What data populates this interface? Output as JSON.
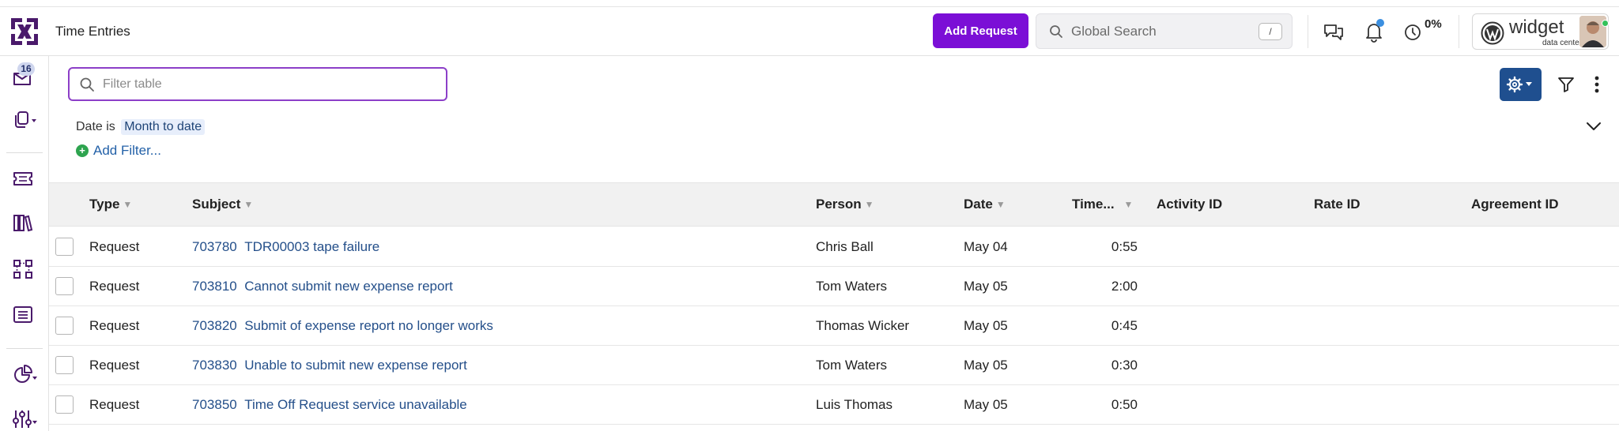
{
  "header": {
    "title": "Time Entries",
    "add_request_label": "Add Request",
    "global_search_placeholder": "Global Search",
    "search_shortcut": "/",
    "timer_percent": "0%",
    "brand_name": "widget",
    "brand_sub": "data center"
  },
  "sidebar": {
    "inbox_badge": "16"
  },
  "filter": {
    "placeholder": "Filter table",
    "date_label": "Date is",
    "date_value": "Month to date",
    "add_filter_label": "Add Filter..."
  },
  "table": {
    "columns": [
      "Type",
      "Subject",
      "Person",
      "Date",
      "Time...",
      "Activity ID",
      "Rate ID",
      "Agreement ID"
    ],
    "rows": [
      {
        "type": "Request",
        "id": "703780",
        "subject": "TDR00003 tape failure",
        "person": "Chris Ball",
        "date": "May 04",
        "time": "0:55"
      },
      {
        "type": "Request",
        "id": "703810",
        "subject": "Cannot submit new expense report",
        "person": "Tom Waters",
        "date": "May 05",
        "time": "2:00"
      },
      {
        "type": "Request",
        "id": "703820",
        "subject": "Submit of expense report no longer works",
        "person": "Thomas Wicker",
        "date": "May 05",
        "time": "0:45"
      },
      {
        "type": "Request",
        "id": "703830",
        "subject": "Unable to submit new expense report",
        "person": "Tom Waters",
        "date": "May 05",
        "time": "0:30"
      },
      {
        "type": "Request",
        "id": "703850",
        "subject": "Time Off Request service unavailable",
        "person": "Luis Thomas",
        "date": "May 05",
        "time": "0:50"
      }
    ]
  },
  "colors": {
    "accent_purple": "#7b0fd6",
    "link_blue": "#244f8a",
    "settings_blue": "#1f4f8f",
    "logo_purple": "#4a1a6b"
  }
}
